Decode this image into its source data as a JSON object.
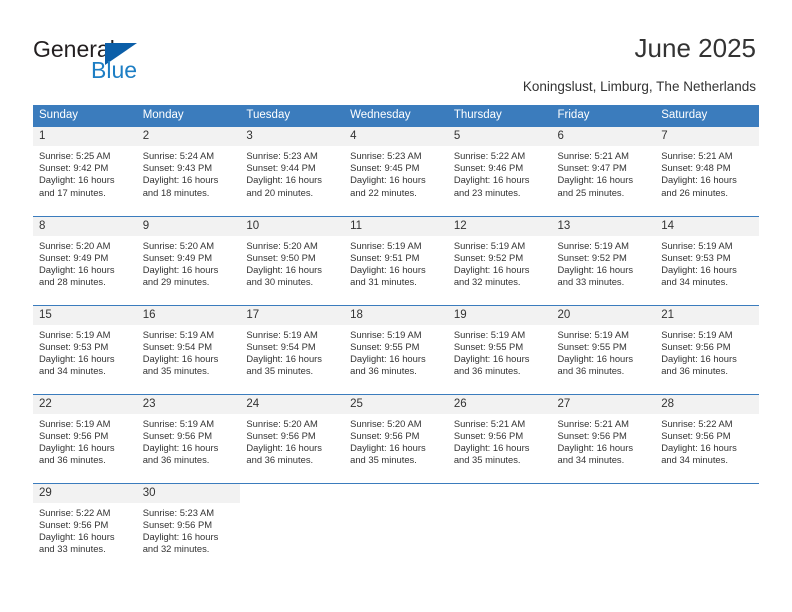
{
  "brand": {
    "name_part1": "General",
    "name_part2": "Blue",
    "triangle_color": "#0b5ea8",
    "blue_text_color": "#1d7ec4"
  },
  "header": {
    "title": "June 2025",
    "subtitle": "Koningslust, Limburg, The Netherlands",
    "accent_color": "#3b7cbd"
  },
  "columns": [
    "Sunday",
    "Monday",
    "Tuesday",
    "Wednesday",
    "Thursday",
    "Friday",
    "Saturday"
  ],
  "weeks": [
    [
      {
        "day": "1",
        "sunrise": "Sunrise: 5:25 AM",
        "sunset": "Sunset: 9:42 PM",
        "daylight_line1": "Daylight: 16 hours",
        "daylight_line2": "and 17 minutes."
      },
      {
        "day": "2",
        "sunrise": "Sunrise: 5:24 AM",
        "sunset": "Sunset: 9:43 PM",
        "daylight_line1": "Daylight: 16 hours",
        "daylight_line2": "and 18 minutes."
      },
      {
        "day": "3",
        "sunrise": "Sunrise: 5:23 AM",
        "sunset": "Sunset: 9:44 PM",
        "daylight_line1": "Daylight: 16 hours",
        "daylight_line2": "and 20 minutes."
      },
      {
        "day": "4",
        "sunrise": "Sunrise: 5:23 AM",
        "sunset": "Sunset: 9:45 PM",
        "daylight_line1": "Daylight: 16 hours",
        "daylight_line2": "and 22 minutes."
      },
      {
        "day": "5",
        "sunrise": "Sunrise: 5:22 AM",
        "sunset": "Sunset: 9:46 PM",
        "daylight_line1": "Daylight: 16 hours",
        "daylight_line2": "and 23 minutes."
      },
      {
        "day": "6",
        "sunrise": "Sunrise: 5:21 AM",
        "sunset": "Sunset: 9:47 PM",
        "daylight_line1": "Daylight: 16 hours",
        "daylight_line2": "and 25 minutes."
      },
      {
        "day": "7",
        "sunrise": "Sunrise: 5:21 AM",
        "sunset": "Sunset: 9:48 PM",
        "daylight_line1": "Daylight: 16 hours",
        "daylight_line2": "and 26 minutes."
      }
    ],
    [
      {
        "day": "8",
        "sunrise": "Sunrise: 5:20 AM",
        "sunset": "Sunset: 9:49 PM",
        "daylight_line1": "Daylight: 16 hours",
        "daylight_line2": "and 28 minutes."
      },
      {
        "day": "9",
        "sunrise": "Sunrise: 5:20 AM",
        "sunset": "Sunset: 9:49 PM",
        "daylight_line1": "Daylight: 16 hours",
        "daylight_line2": "and 29 minutes."
      },
      {
        "day": "10",
        "sunrise": "Sunrise: 5:20 AM",
        "sunset": "Sunset: 9:50 PM",
        "daylight_line1": "Daylight: 16 hours",
        "daylight_line2": "and 30 minutes."
      },
      {
        "day": "11",
        "sunrise": "Sunrise: 5:19 AM",
        "sunset": "Sunset: 9:51 PM",
        "daylight_line1": "Daylight: 16 hours",
        "daylight_line2": "and 31 minutes."
      },
      {
        "day": "12",
        "sunrise": "Sunrise: 5:19 AM",
        "sunset": "Sunset: 9:52 PM",
        "daylight_line1": "Daylight: 16 hours",
        "daylight_line2": "and 32 minutes."
      },
      {
        "day": "13",
        "sunrise": "Sunrise: 5:19 AM",
        "sunset": "Sunset: 9:52 PM",
        "daylight_line1": "Daylight: 16 hours",
        "daylight_line2": "and 33 minutes."
      },
      {
        "day": "14",
        "sunrise": "Sunrise: 5:19 AM",
        "sunset": "Sunset: 9:53 PM",
        "daylight_line1": "Daylight: 16 hours",
        "daylight_line2": "and 34 minutes."
      }
    ],
    [
      {
        "day": "15",
        "sunrise": "Sunrise: 5:19 AM",
        "sunset": "Sunset: 9:53 PM",
        "daylight_line1": "Daylight: 16 hours",
        "daylight_line2": "and 34 minutes."
      },
      {
        "day": "16",
        "sunrise": "Sunrise: 5:19 AM",
        "sunset": "Sunset: 9:54 PM",
        "daylight_line1": "Daylight: 16 hours",
        "daylight_line2": "and 35 minutes."
      },
      {
        "day": "17",
        "sunrise": "Sunrise: 5:19 AM",
        "sunset": "Sunset: 9:54 PM",
        "daylight_line1": "Daylight: 16 hours",
        "daylight_line2": "and 35 minutes."
      },
      {
        "day": "18",
        "sunrise": "Sunrise: 5:19 AM",
        "sunset": "Sunset: 9:55 PM",
        "daylight_line1": "Daylight: 16 hours",
        "daylight_line2": "and 36 minutes."
      },
      {
        "day": "19",
        "sunrise": "Sunrise: 5:19 AM",
        "sunset": "Sunset: 9:55 PM",
        "daylight_line1": "Daylight: 16 hours",
        "daylight_line2": "and 36 minutes."
      },
      {
        "day": "20",
        "sunrise": "Sunrise: 5:19 AM",
        "sunset": "Sunset: 9:55 PM",
        "daylight_line1": "Daylight: 16 hours",
        "daylight_line2": "and 36 minutes."
      },
      {
        "day": "21",
        "sunrise": "Sunrise: 5:19 AM",
        "sunset": "Sunset: 9:56 PM",
        "daylight_line1": "Daylight: 16 hours",
        "daylight_line2": "and 36 minutes."
      }
    ],
    [
      {
        "day": "22",
        "sunrise": "Sunrise: 5:19 AM",
        "sunset": "Sunset: 9:56 PM",
        "daylight_line1": "Daylight: 16 hours",
        "daylight_line2": "and 36 minutes."
      },
      {
        "day": "23",
        "sunrise": "Sunrise: 5:19 AM",
        "sunset": "Sunset: 9:56 PM",
        "daylight_line1": "Daylight: 16 hours",
        "daylight_line2": "and 36 minutes."
      },
      {
        "day": "24",
        "sunrise": "Sunrise: 5:20 AM",
        "sunset": "Sunset: 9:56 PM",
        "daylight_line1": "Daylight: 16 hours",
        "daylight_line2": "and 36 minutes."
      },
      {
        "day": "25",
        "sunrise": "Sunrise: 5:20 AM",
        "sunset": "Sunset: 9:56 PM",
        "daylight_line1": "Daylight: 16 hours",
        "daylight_line2": "and 35 minutes."
      },
      {
        "day": "26",
        "sunrise": "Sunrise: 5:21 AM",
        "sunset": "Sunset: 9:56 PM",
        "daylight_line1": "Daylight: 16 hours",
        "daylight_line2": "and 35 minutes."
      },
      {
        "day": "27",
        "sunrise": "Sunrise: 5:21 AM",
        "sunset": "Sunset: 9:56 PM",
        "daylight_line1": "Daylight: 16 hours",
        "daylight_line2": "and 34 minutes."
      },
      {
        "day": "28",
        "sunrise": "Sunrise: 5:22 AM",
        "sunset": "Sunset: 9:56 PM",
        "daylight_line1": "Daylight: 16 hours",
        "daylight_line2": "and 34 minutes."
      }
    ],
    [
      {
        "day": "29",
        "sunrise": "Sunrise: 5:22 AM",
        "sunset": "Sunset: 9:56 PM",
        "daylight_line1": "Daylight: 16 hours",
        "daylight_line2": "and 33 minutes."
      },
      {
        "day": "30",
        "sunrise": "Sunrise: 5:23 AM",
        "sunset": "Sunset: 9:56 PM",
        "daylight_line1": "Daylight: 16 hours",
        "daylight_line2": "and 32 minutes."
      },
      {
        "day": "",
        "sunrise": "",
        "sunset": "",
        "daylight_line1": "",
        "daylight_line2": ""
      },
      {
        "day": "",
        "sunrise": "",
        "sunset": "",
        "daylight_line1": "",
        "daylight_line2": ""
      },
      {
        "day": "",
        "sunrise": "",
        "sunset": "",
        "daylight_line1": "",
        "daylight_line2": ""
      },
      {
        "day": "",
        "sunrise": "",
        "sunset": "",
        "daylight_line1": "",
        "daylight_line2": ""
      },
      {
        "day": "",
        "sunrise": "",
        "sunset": "",
        "daylight_line1": "",
        "daylight_line2": ""
      }
    ]
  ]
}
